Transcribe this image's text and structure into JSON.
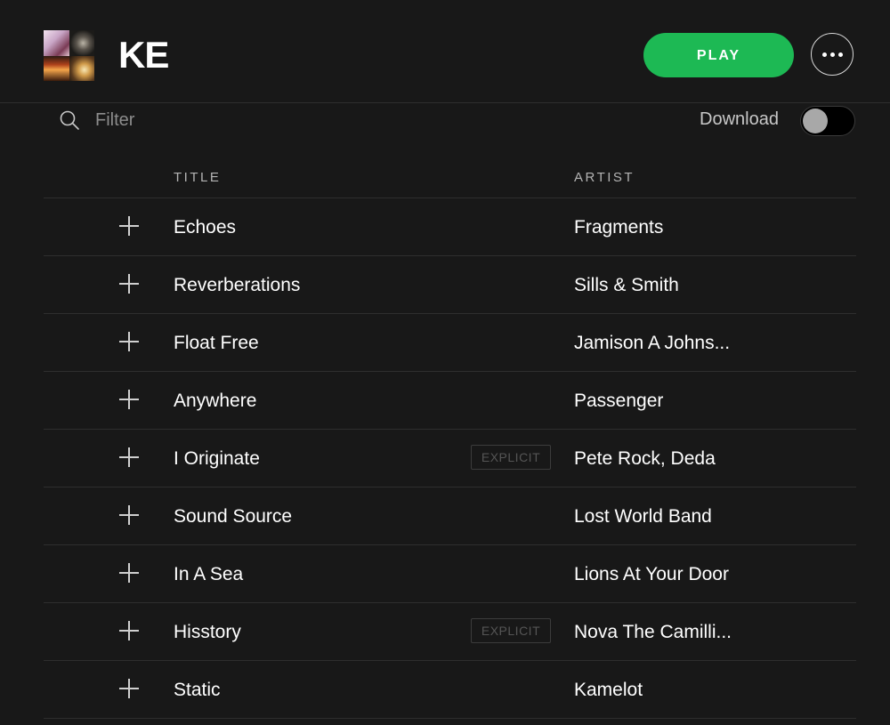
{
  "playlist": {
    "title": "KE",
    "play_label": "PLAY"
  },
  "filter": {
    "placeholder": "Filter",
    "value": ""
  },
  "download": {
    "label": "Download",
    "enabled": false
  },
  "table": {
    "headers": {
      "title": "TITLE",
      "artist": "ARTIST"
    },
    "explicit_label": "EXPLICIT",
    "rows": [
      {
        "title": "Echoes",
        "artist": "Fragments",
        "explicit": false
      },
      {
        "title": "Reverberations",
        "artist": "Sills & Smith",
        "explicit": false
      },
      {
        "title": "Float Free",
        "artist": "Jamison A Johns...",
        "explicit": false
      },
      {
        "title": "Anywhere",
        "artist": "Passenger",
        "explicit": false
      },
      {
        "title": "I Originate",
        "artist": "Pete Rock, Deda",
        "explicit": true
      },
      {
        "title": "Sound Source",
        "artist": "Lost World Band",
        "explicit": false
      },
      {
        "title": "In A Sea",
        "artist": "Lions At Your Door",
        "explicit": false
      },
      {
        "title": "Hisstory",
        "artist": "Nova The Camilli...",
        "explicit": true
      },
      {
        "title": "Static",
        "artist": "Kamelot",
        "explicit": false
      }
    ]
  },
  "icons": {
    "search": "search-icon",
    "more": "more-options-icon",
    "add": "plus-icon"
  },
  "colors": {
    "background": "#181818",
    "accent": "#1db954",
    "divider": "#2e2e2e",
    "muted_text": "#b3b3b3"
  }
}
